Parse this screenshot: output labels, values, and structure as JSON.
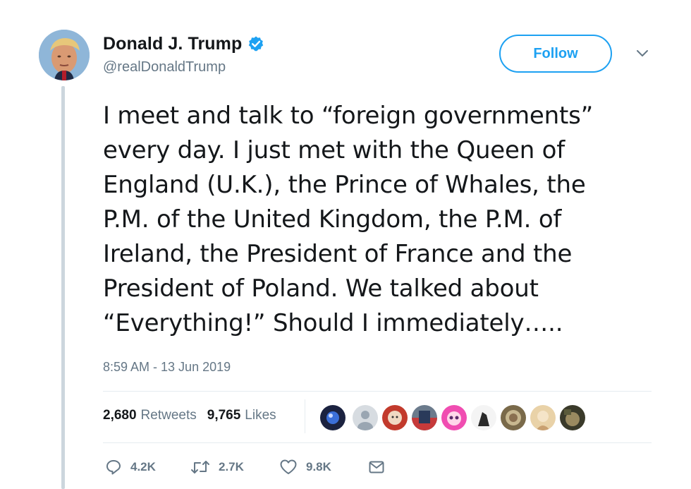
{
  "author": {
    "name": "Donald J. Trump",
    "handle": "@realDonaldTrump",
    "verified": true
  },
  "follow_button": {
    "label": "Follow"
  },
  "menu": {
    "icon": "chevron-down-icon"
  },
  "tweet": {
    "text": "I meet and talk to “foreign governments”\nevery day. I just met with the Queen of\nEngland (U.K.), the Prince of Whales, the\nP.M. of the United Kingdom, the P.M. of\nIreland, the President of France and the\nPresident of Poland. We talked about\n“Everything!” Should I immediately…..",
    "timestamp": "8:59 AM - 13 Jun 2019"
  },
  "stats": {
    "retweets": {
      "count": "2,680",
      "label": "Retweets"
    },
    "likes": {
      "count": "9,765",
      "label": "Likes"
    }
  },
  "liker_avatars_count": 9,
  "actions": {
    "reply": {
      "icon": "reply-icon",
      "count": "4.2K"
    },
    "retweet": {
      "icon": "retweet-icon",
      "count": "2.7K"
    },
    "like": {
      "icon": "heart-icon",
      "count": "9.8K"
    },
    "message": {
      "icon": "envelope-icon"
    }
  },
  "colors": {
    "accent": "#1da1f2",
    "text": "#14171a",
    "muted": "#657786",
    "border": "#e6ecf0",
    "thread_line": "#ccd6dd"
  }
}
